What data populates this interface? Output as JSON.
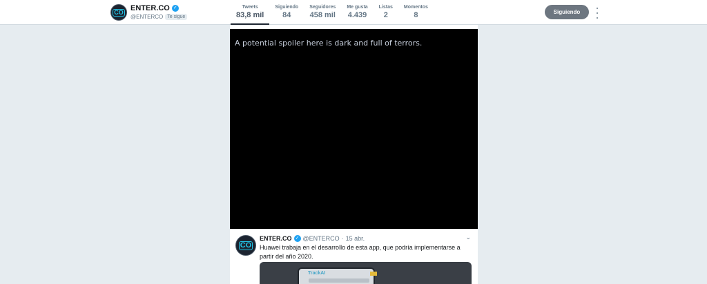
{
  "profile": {
    "name": "ENTER.CO",
    "handle": "@ENTERCO",
    "follows_you": "Te sigue",
    "logo_text": "CO"
  },
  "stats": [
    {
      "label": "Tweets",
      "value": "83,8 mil",
      "active": true
    },
    {
      "label": "Siguiendo",
      "value": "84"
    },
    {
      "label": "Seguidores",
      "value": "458 mil"
    },
    {
      "label": "Me gusta",
      "value": "4.439"
    },
    {
      "label": "Listas",
      "value": "2"
    },
    {
      "label": "Momentos",
      "value": "8"
    }
  ],
  "actions": {
    "following_button": "Siguiendo"
  },
  "spoiler": {
    "text": "A potential spoiler here is dark and full of terrors."
  },
  "tweet": {
    "name": "ENTER.CO",
    "handle": "@ENTERCO",
    "separator": "·",
    "date": "15 abr.",
    "text": "Huawei trabaja en el desarrollo de esta app, que podría implementarse a partir del año 2020.",
    "media_app_label": "TrackAI"
  },
  "colors": {
    "page_bg": "#e6ecf0",
    "verified": "#1da1f2",
    "logo_accent": "#22c3e6",
    "button": "#6d7680"
  },
  "icons": [
    "verified-badge-icon",
    "more-options-icon",
    "chevron-down-icon"
  ]
}
